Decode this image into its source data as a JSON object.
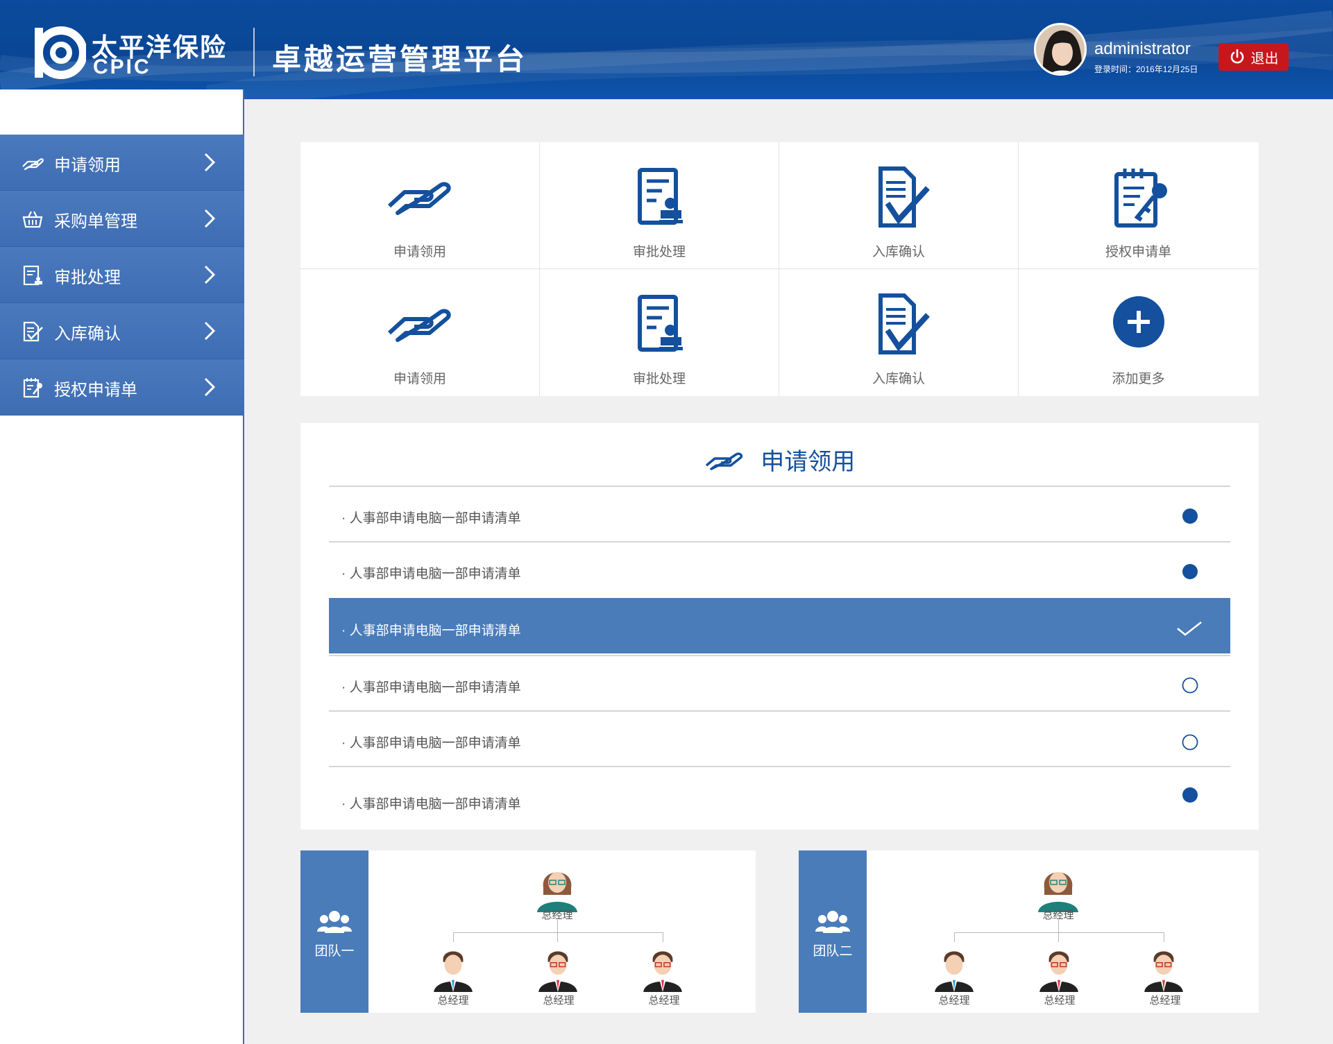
{
  "header": {
    "brand_cn": "太平洋保险",
    "brand_en": "CPIC",
    "platform_title": "卓越运营管理平台",
    "username": "administrator",
    "login_time": "登录时间：2016年12月25日",
    "logout_label": "退出"
  },
  "sidebar": {
    "items": [
      {
        "label": "申请领用",
        "icon": "hand-icon"
      },
      {
        "label": "采购单管理",
        "icon": "basket-icon"
      },
      {
        "label": "审批处理",
        "icon": "approval-icon"
      },
      {
        "label": "入库确认",
        "icon": "document-check-icon"
      },
      {
        "label": "授权申请单",
        "icon": "notepad-key-icon"
      }
    ]
  },
  "quick": {
    "items": [
      {
        "label": "申请领用",
        "icon": "hand-icon"
      },
      {
        "label": "审批处理",
        "icon": "approval-icon"
      },
      {
        "label": "入库确认",
        "icon": "document-check-icon"
      },
      {
        "label": "授权申请单",
        "icon": "notepad-key-icon"
      },
      {
        "label": "申请领用",
        "icon": "hand-icon"
      },
      {
        "label": "审批处理",
        "icon": "approval-icon"
      },
      {
        "label": "入库确认",
        "icon": "document-check-icon"
      },
      {
        "label": "添加更多",
        "icon": "plus-circle-icon"
      }
    ]
  },
  "list": {
    "title": "申请领用",
    "rows": [
      {
        "text": "· 人事部申请电脑一部申请清单",
        "status": "filled"
      },
      {
        "text": "· 人事部申请电脑一部申请清单",
        "status": "filled"
      },
      {
        "text": "· 人事部申请电脑一部申请清单",
        "status": "checked"
      },
      {
        "text": "· 人事部申请电脑一部申请清单",
        "status": "empty"
      },
      {
        "text": "· 人事部申请电脑一部申请清单",
        "status": "empty"
      },
      {
        "text": "· 人事部申请电脑一部申请清单",
        "status": "filled"
      }
    ]
  },
  "teams": [
    {
      "name": "团队一",
      "manager": "总经理",
      "members": [
        "总经理",
        "总经理",
        "总经理"
      ]
    },
    {
      "name": "团队二",
      "manager": "总经理",
      "members": [
        "总经理",
        "总经理",
        "总经理"
      ]
    }
  ],
  "colors": {
    "header_blue": "#0b4a9c",
    "sidebar_blue": "#4a79bd",
    "icon_blue": "#14509d",
    "selected_row": "#4a7cba",
    "logout_red": "#c8161d"
  }
}
